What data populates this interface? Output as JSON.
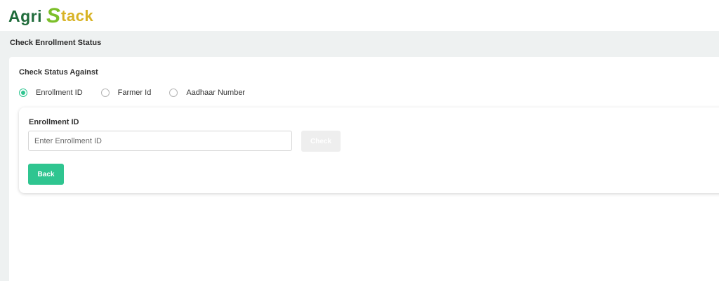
{
  "header": {
    "logo_part1": "Agri",
    "logo_part2_s": "S",
    "logo_part2_rest": "tack"
  },
  "page": {
    "title": "Check Enrollment Status"
  },
  "form": {
    "check_against_label": "Check Status Against",
    "options": [
      {
        "label": "Enrollment ID",
        "selected": true
      },
      {
        "label": "Farmer Id",
        "selected": false
      },
      {
        "label": "Aadhaar Number",
        "selected": false
      }
    ],
    "field_label": "Enrollment ID",
    "field_placeholder": "Enter Enrollment ID",
    "field_value": "",
    "check_label": "Check",
    "back_label": "Back"
  },
  "colors": {
    "accent": "#2fc590",
    "logo_green_dark": "#1f6b3a",
    "logo_green_light": "#7cbf2a",
    "logo_yellow": "#d8b325",
    "page_band": "#eef1f1",
    "check_disabled": "#eeeeee"
  },
  "icons": {
    "radio_selected": "radio-selected-icon",
    "radio_unselected": "radio-unselected-icon"
  }
}
